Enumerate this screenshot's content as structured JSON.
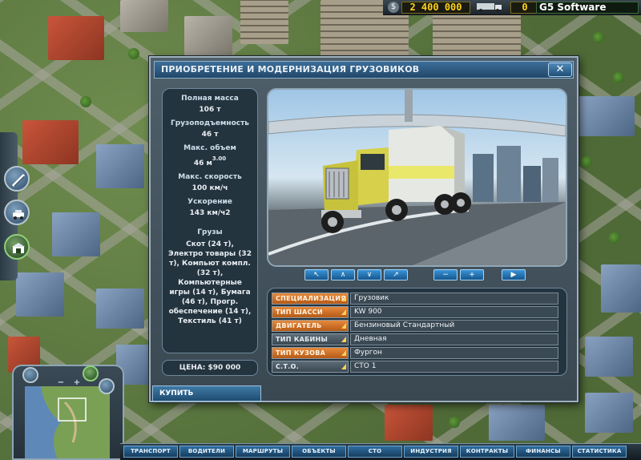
{
  "topbar": {
    "money": "2 400 000",
    "trucks": "0",
    "company": "G5 Software",
    "money_icon": "dollar-icon",
    "company_icon": "copyright-icon"
  },
  "dialog": {
    "title": "ПРИОБРЕТЕНИЕ И МОДЕРНИЗАЦИЯ ГРУЗОВИКОВ",
    "close": "✕",
    "specs": [
      {
        "label": "Полная масса",
        "value": "106  т"
      },
      {
        "label": "Грузоподъемность",
        "value": "46  т"
      },
      {
        "label": "Макс. объем",
        "value": "46  м",
        "sup": "3.00"
      },
      {
        "label": "Макс. скорость",
        "value": "100  км/ч"
      },
      {
        "label": "Ускорение",
        "value": "143  км/ч2"
      }
    ],
    "cargo_title": "Грузы",
    "cargo_text": "Скот (24 т), Электро товары (32 т), Компьют компл. (32 т), Компьютерные игры (14 т), Бумага (46 т), Прогр. обеспечение (14 т), Текстиль (41 т)",
    "price": "ЦЕНА:    $90 000",
    "buy": "КУПИТЬ",
    "nav_buttons": [
      "↖",
      "∧",
      "∨",
      "↗",
      "−",
      "+",
      "▶"
    ],
    "options": [
      {
        "key": "СПЕЦИАЛИЗАЦИЯ",
        "value": "Грузовик",
        "style": "orange"
      },
      {
        "key": "ТИП ШАССИ",
        "value": "KW 900",
        "style": "orange"
      },
      {
        "key": "ДВИГАТЕЛЬ",
        "value": "Бензиновый Стандартный",
        "style": "orange"
      },
      {
        "key": "ТИП КАБИНЫ",
        "value": "Дневная",
        "style": "grey"
      },
      {
        "key": "ТИП КУЗОВА",
        "value": "Фургон",
        "style": "orange"
      },
      {
        "key": "С.Т.О.",
        "value": "СТО 1",
        "style": "grey"
      }
    ]
  },
  "minimap": {
    "minus": "−",
    "plus": "+"
  },
  "bottom_menu": [
    "ТРАНСПОРТ",
    "ВОДИТЕЛИ",
    "МАРШРУТЫ",
    "ОБЪЕКТЫ",
    "СТО",
    "ИНДУСТРИЯ",
    "КОНТРАКТЫ",
    "ФИНАНСЫ",
    "СТАТИСТИКА"
  ],
  "colors": {
    "accent": "#2f6da0",
    "option_active": "#e58a3c",
    "money": "#ffd21a"
  }
}
